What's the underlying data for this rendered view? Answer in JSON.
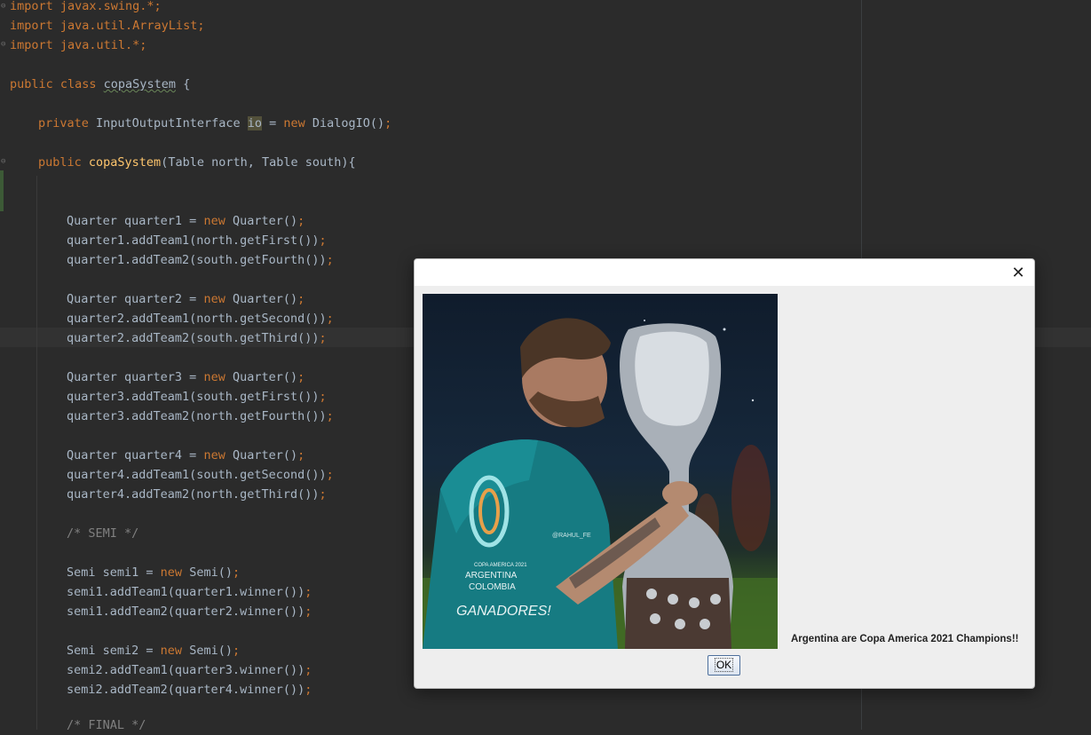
{
  "editor": {
    "lines": {
      "l1": [
        "import javax.swing.*;"
      ],
      "l2": [
        "import java.util.ArrayList;"
      ],
      "l3": [
        "import java.util.*;"
      ],
      "l4": [
        "public class ",
        "copaSystem",
        " {"
      ],
      "l5": [
        "private ",
        "InputOutputInterface ",
        "io",
        " = ",
        "new ",
        "DialogIO()",
        ";"
      ],
      "l6": [
        "public ",
        "copaSystem",
        "(Table north, Table south){"
      ],
      "l7": [
        "Quarter quarter1 = ",
        "new ",
        "Quarter()",
        ";"
      ],
      "l8": [
        "quarter1.addTeam1(north.getFirst())",
        ";"
      ],
      "l9": [
        "quarter1.addTeam2(south.getFourth())",
        ";"
      ],
      "l10": [
        "Quarter quarter2 = ",
        "new ",
        "Quarter()",
        ";"
      ],
      "l11": [
        "quarter2.addTeam1(north.getSecond())",
        ";"
      ],
      "l12": [
        "quarter2.addTeam2(south.getThird())",
        ";"
      ],
      "l13": [
        "Quarter quarter3 = ",
        "new ",
        "Quarter()",
        ";"
      ],
      "l14": [
        "quarter3.addTeam1(south.getFirst())",
        ";"
      ],
      "l15": [
        "quarter3.addTeam2(north.getFourth())",
        ";"
      ],
      "l16": [
        "Quarter quarter4 = ",
        "new ",
        "Quarter()",
        ";"
      ],
      "l17": [
        "quarter4.addTeam1(south.getSecond())",
        ";"
      ],
      "l18": [
        "quarter4.addTeam2(north.getThird())",
        ";"
      ],
      "l19": [
        "/* SEMI */"
      ],
      "l20": [
        "Semi semi1 = ",
        "new ",
        "Semi()",
        ";"
      ],
      "l21": [
        "semi1.addTeam1(quarter1.winner())",
        ";"
      ],
      "l22": [
        "semi1.addTeam2(quarter2.winner())",
        ";"
      ],
      "l23": [
        "Semi semi2 = ",
        "new ",
        "Semi()",
        ";"
      ],
      "l24": [
        "semi2.addTeam1(quarter3.winner())",
        ";"
      ],
      "l25": [
        "semi2.addTeam2(quarter4.winner())",
        ";"
      ],
      "l26": [
        "/* FINAL */"
      ]
    }
  },
  "dialog": {
    "close_glyph": "✕",
    "photo": {
      "shirt_text_1": "COPA AMERICA 2021",
      "shirt_text_2": "ARGENTINA",
      "shirt_text_3": "COLOMBIA",
      "shirt_text_4": "GANADORES!",
      "credit": "@RAHUL_FE"
    },
    "message": "Argentina are Copa America 2021 Champions!!",
    "ok_label": "OK"
  },
  "colors": {
    "editor_bg": "#2b2b2b",
    "keyword": "#cc7832",
    "function": "#ffc66d",
    "text": "#a9b7c6",
    "comment": "#808080",
    "dialog_bg": "#eeeeee"
  },
  "icons": [
    "fold-icon",
    "close-icon"
  ]
}
